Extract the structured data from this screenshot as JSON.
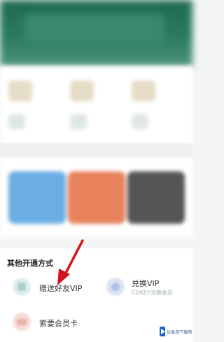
{
  "section": {
    "title": "其他开通方式"
  },
  "options": [
    {
      "label": "赠送好友VIP",
      "subtitle": "",
      "icon": "gift-icon",
      "color": "#dfeeec"
    },
    {
      "label": "兑换VIP",
      "subtitle": "CDKEY兑换会员",
      "icon": "exchange-icon",
      "color": "#dce3f3"
    },
    {
      "label": "索要会员卡",
      "subtitle": "",
      "icon": "card-icon",
      "color": "#f6dcd8"
    }
  ],
  "annotation": {
    "arrow_color": "#d4141c"
  },
  "watermark": {
    "text": "优易游下载网",
    "color": "#1a66c8"
  },
  "colors": {
    "banner": "#2b7a5f",
    "card_blue": "#6aaee4",
    "card_orange": "#e8825b",
    "card_dark": "#555555"
  }
}
